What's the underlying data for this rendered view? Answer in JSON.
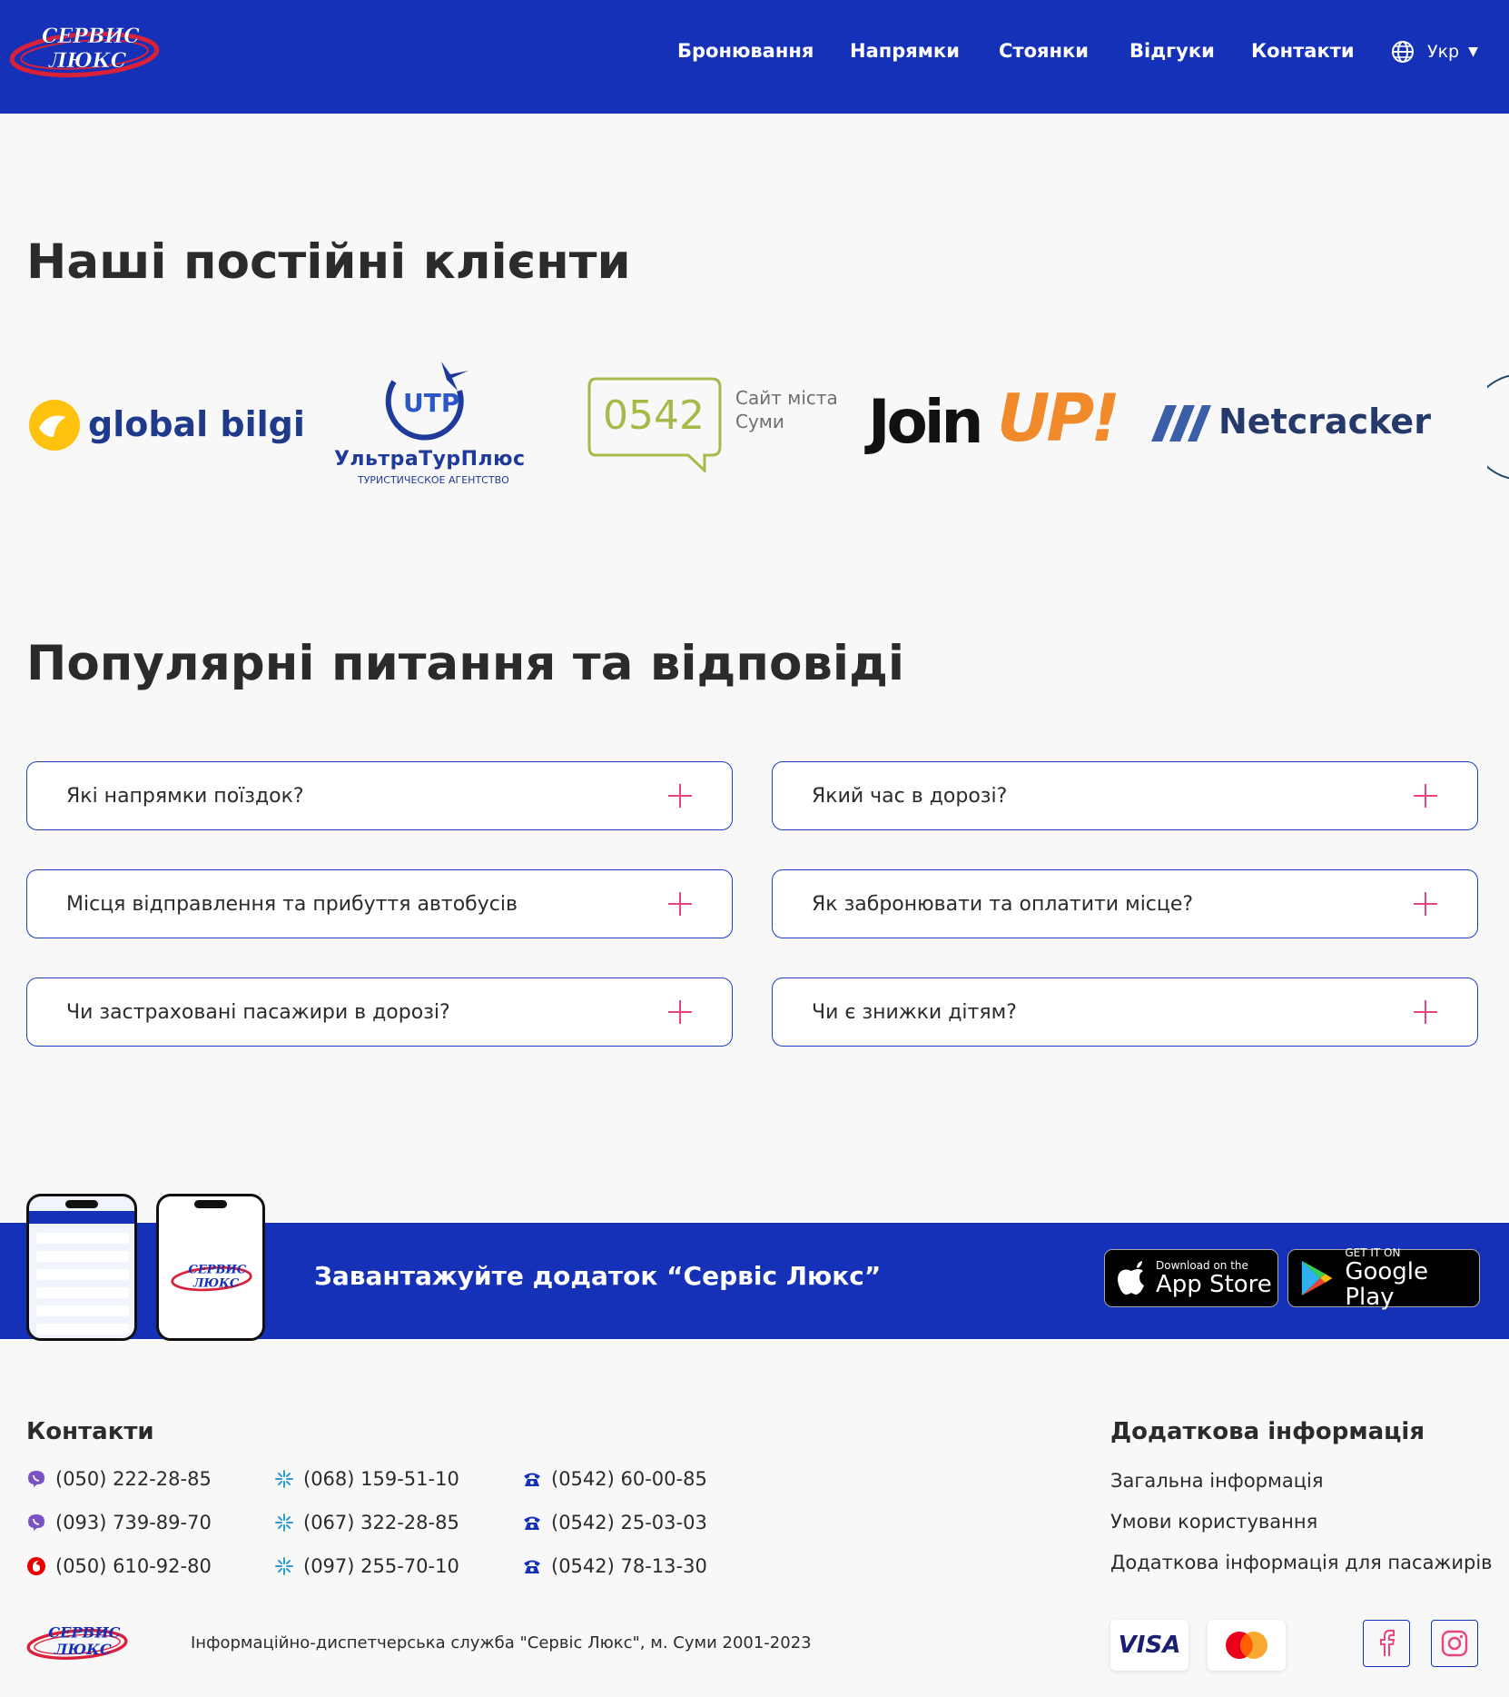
{
  "header": {
    "logo_line1": "СЕРВИС",
    "logo_line2": "ЛЮКС",
    "nav": [
      "Бронювання",
      "Напрямки",
      "Стоянки",
      "Відгуки",
      "Контакти"
    ],
    "language": "Укр"
  },
  "clients": {
    "title": "Наші постійні клієнти",
    "logos": [
      {
        "name": "global bilgi"
      },
      {
        "name": "UTP",
        "subtitle": "УльтраТурПлюс",
        "caption": "ТУРИСТИЧЕСКОЕ АГЕНТСТВО"
      },
      {
        "name": "0542",
        "caption_line1": "Сайт міста",
        "caption_line2": "Суми"
      },
      {
        "name_part1": "Join",
        "name_part2": "UP!"
      },
      {
        "name": "Netcracker"
      }
    ]
  },
  "faq": {
    "title": "Популярні питання та відповіді",
    "items": [
      "Які напрямки поїздок?",
      "Який час в дорозі?",
      "Місця відправлення та прибуття автобусів",
      "Як забронювати та оплатити місце?",
      "Чи застраховані пасажири в дорозі?",
      "Чи є знижки дітям?"
    ]
  },
  "app_banner": {
    "title": "Завантажуйте додаток “Сервіс Люкс”",
    "app_store_small": "Download on the",
    "app_store_big": "App Store",
    "google_small": "GET IT ON",
    "google_big": "Google Play"
  },
  "footer": {
    "contacts_title": "Контакти",
    "phones_col1": [
      {
        "icon": "viber-icon",
        "number": "(050) 222-28-85"
      },
      {
        "icon": "viber-icon",
        "number": "(093) 739-89-70"
      },
      {
        "icon": "vodafone-icon",
        "number": "(050) 610-92-80"
      }
    ],
    "phones_col2": [
      {
        "icon": "kyivstar-icon",
        "number": "(068) 159-51-10"
      },
      {
        "icon": "kyivstar-icon",
        "number": "(067) 322-28-85"
      },
      {
        "icon": "kyivstar-icon",
        "number": "(097) 255-70-10"
      }
    ],
    "phones_col3": [
      {
        "icon": "landline-phone-icon",
        "number": "(0542) 60-00-85"
      },
      {
        "icon": "landline-phone-icon",
        "number": "(0542) 25-03-03"
      },
      {
        "icon": "landline-phone-icon",
        "number": "(0542) 78-13-30"
      }
    ],
    "info_title": "Додаткова інформація",
    "info_links": [
      "Загальна інформація",
      "Умови користування",
      "Додаткова інформація для пасажирів"
    ],
    "copyright": "Інформаційно-диспетчерська служба \"Сервіс Люкс\", м. Суми 2001-2023",
    "payment": [
      "VISA",
      "mastercard"
    ],
    "social": [
      "facebook-icon",
      "instagram-icon"
    ]
  },
  "colors": {
    "brand_blue": "#1531b8",
    "accent_pink": "#e8467c",
    "logo_red": "#d9213a"
  }
}
